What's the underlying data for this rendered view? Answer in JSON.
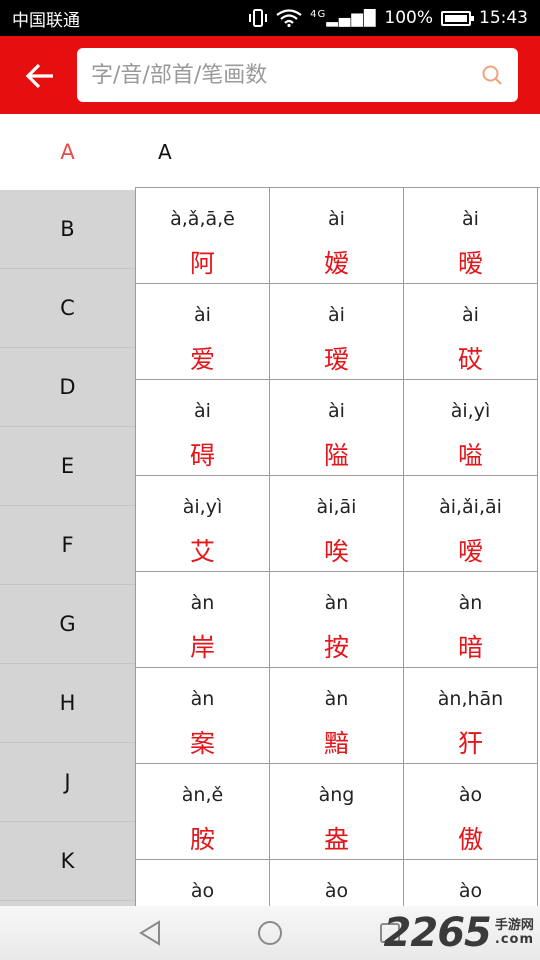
{
  "status_bar": {
    "carrier": "中国联通",
    "network": "4G",
    "battery": "100%",
    "time": "15:43"
  },
  "header": {
    "search_placeholder": "字/音/部首/笔画数"
  },
  "index": {
    "active_letter": "A",
    "section_title": "A",
    "letters": [
      "B",
      "C",
      "D",
      "E",
      "F",
      "G",
      "H",
      "J",
      "K"
    ]
  },
  "grid": {
    "cells": [
      {
        "pinyin": "à,ǎ,ā,ē",
        "hanzi": "阿"
      },
      {
        "pinyin": "ài",
        "hanzi": "嫒"
      },
      {
        "pinyin": "ài",
        "hanzi": "暧"
      },
      {
        "pinyin": "ài",
        "hanzi": "爱"
      },
      {
        "pinyin": "ài",
        "hanzi": "瑷"
      },
      {
        "pinyin": "ài",
        "hanzi": "砹"
      },
      {
        "pinyin": "ài",
        "hanzi": "碍"
      },
      {
        "pinyin": "ài",
        "hanzi": "隘"
      },
      {
        "pinyin": "ài,yì",
        "hanzi": "嗌"
      },
      {
        "pinyin": "ài,yì",
        "hanzi": "艾"
      },
      {
        "pinyin": "ài,āi",
        "hanzi": "唉"
      },
      {
        "pinyin": "ài,ǎi,āi",
        "hanzi": "嗳"
      },
      {
        "pinyin": "àn",
        "hanzi": "岸"
      },
      {
        "pinyin": "àn",
        "hanzi": "按"
      },
      {
        "pinyin": "àn",
        "hanzi": "暗"
      },
      {
        "pinyin": "àn",
        "hanzi": "案"
      },
      {
        "pinyin": "àn",
        "hanzi": "黯"
      },
      {
        "pinyin": "àn,hān",
        "hanzi": "犴"
      },
      {
        "pinyin": "àn,ě",
        "hanzi": "胺"
      },
      {
        "pinyin": "àng",
        "hanzi": "盎"
      },
      {
        "pinyin": "ào",
        "hanzi": "傲"
      },
      {
        "pinyin": "ào",
        "hanzi": ""
      },
      {
        "pinyin": "ào",
        "hanzi": ""
      },
      {
        "pinyin": "ào",
        "hanzi": ""
      }
    ]
  },
  "watermark": {
    "number": "2265",
    "cn": "手游网",
    "com": ".com"
  },
  "colors": {
    "header": "#e60e0e",
    "hanzi": "#e3161b",
    "active_letter": "#e94b4b",
    "sidebar": "#d4d4d4"
  },
  "icons": {
    "back": "arrow-left-icon",
    "search": "search-icon",
    "nav": [
      "back-triangle-icon",
      "home-circle-icon",
      "recents-square-icon"
    ]
  }
}
